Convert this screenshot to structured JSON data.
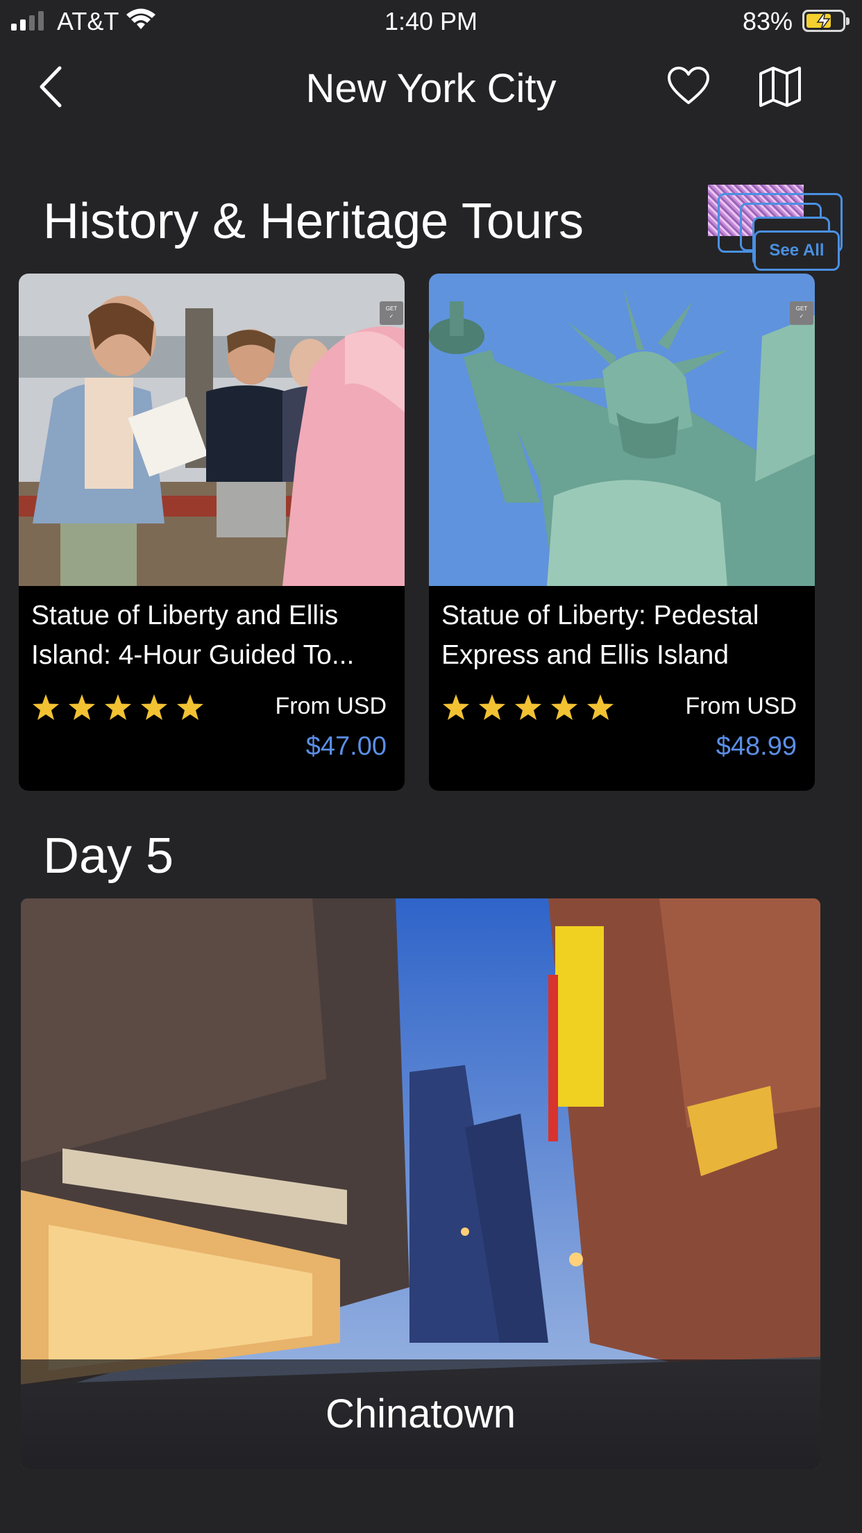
{
  "status_bar": {
    "carrier": "AT&T",
    "time": "1:40 PM",
    "battery": "83%"
  },
  "nav": {
    "title": "New York City"
  },
  "section": {
    "title": "History & Heritage Tours",
    "see_all": "See All"
  },
  "tours": [
    {
      "title": "Statue of Liberty and Ellis Island: 4-Hour Guided To...",
      "rating": 5,
      "from_label": "From USD",
      "price": "$47.00"
    },
    {
      "title": "Statue of Liberty: Pedestal Express and Ellis Island",
      "rating": 5,
      "from_label": "From USD",
      "price": "$48.99"
    }
  ],
  "day": {
    "title": "Day 5",
    "place": "Chinatown"
  },
  "colors": {
    "background": "#242426",
    "accent": "#5b8fe6",
    "star": "#f2c233"
  }
}
